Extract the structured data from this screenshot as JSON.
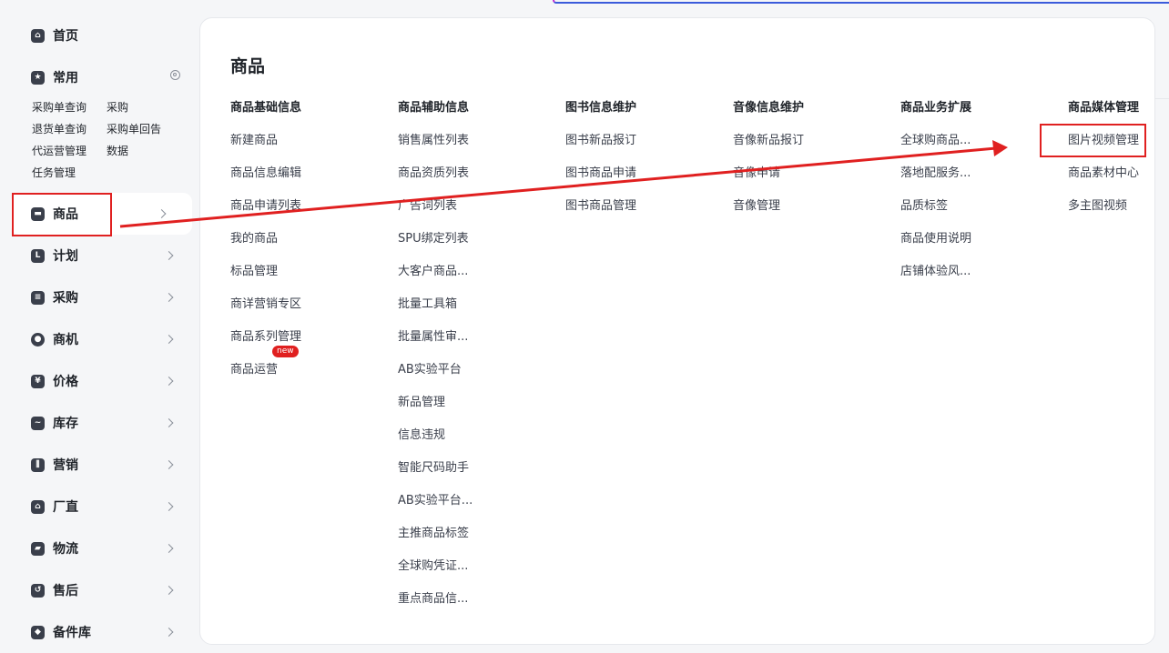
{
  "sidebar": {
    "home": {
      "label": "首页",
      "icon": "home-icon"
    },
    "common": {
      "label": "常用",
      "icon": "star-icon",
      "links": [
        [
          "采购单查询",
          "采购"
        ],
        [
          "退货单查询",
          "采购单回告"
        ],
        [
          "代运营管理",
          "数据"
        ],
        [
          "任务管理"
        ]
      ]
    },
    "nav": [
      {
        "label": "商品",
        "icon": "product-icon",
        "active": true
      },
      {
        "label": "计划",
        "icon": "plan-icon"
      },
      {
        "label": "采购",
        "icon": "purchase-icon"
      },
      {
        "label": "商机",
        "icon": "opportunity-icon"
      },
      {
        "label": "价格",
        "icon": "price-icon"
      },
      {
        "label": "库存",
        "icon": "inventory-icon"
      },
      {
        "label": "营销",
        "icon": "marketing-icon"
      },
      {
        "label": "厂直",
        "icon": "factory-icon"
      },
      {
        "label": "物流",
        "icon": "logistics-icon"
      },
      {
        "label": "售后",
        "icon": "aftersale-icon"
      },
      {
        "label": "备件库",
        "icon": "spare-parts-icon"
      }
    ]
  },
  "panel": {
    "title": "商品",
    "columns": [
      {
        "head": "商品基础信息",
        "items": [
          "新建商品",
          "商品信息编辑",
          "商品申请列表",
          "我的商品",
          "标品管理",
          "商详营销专区",
          "商品系列管理",
          "商品运营"
        ]
      },
      {
        "head": "商品辅助信息",
        "items": [
          "销售属性列表",
          "商品资质列表",
          "广告词列表",
          "SPU绑定列表",
          "大客户商品...",
          "批量工具箱",
          "批量属性审...",
          "AB实验平台",
          "新品管理",
          "信息违规",
          "智能尺码助手",
          "AB实验平台...",
          "主推商品标签",
          "全球购凭证...",
          "重点商品信..."
        ]
      },
      {
        "head": "图书信息维护",
        "items": [
          "图书新品报订",
          "图书商品申请",
          "图书商品管理"
        ]
      },
      {
        "head": "音像信息维护",
        "items": [
          "音像新品报订",
          "音像申请",
          "音像管理"
        ]
      },
      {
        "head": "商品业务扩展",
        "items": [
          "全球购商品...",
          "落地配服务...",
          "品质标签",
          "商品使用说明",
          "店铺体验风..."
        ]
      },
      {
        "head": "商品媒体管理",
        "items": [
          "图片视频管理",
          "商品素材中心",
          "多主图视频"
        ]
      }
    ],
    "new_badge": "new"
  },
  "colors": {
    "annotation": "#e02020",
    "accent": "#3b5bdb"
  }
}
